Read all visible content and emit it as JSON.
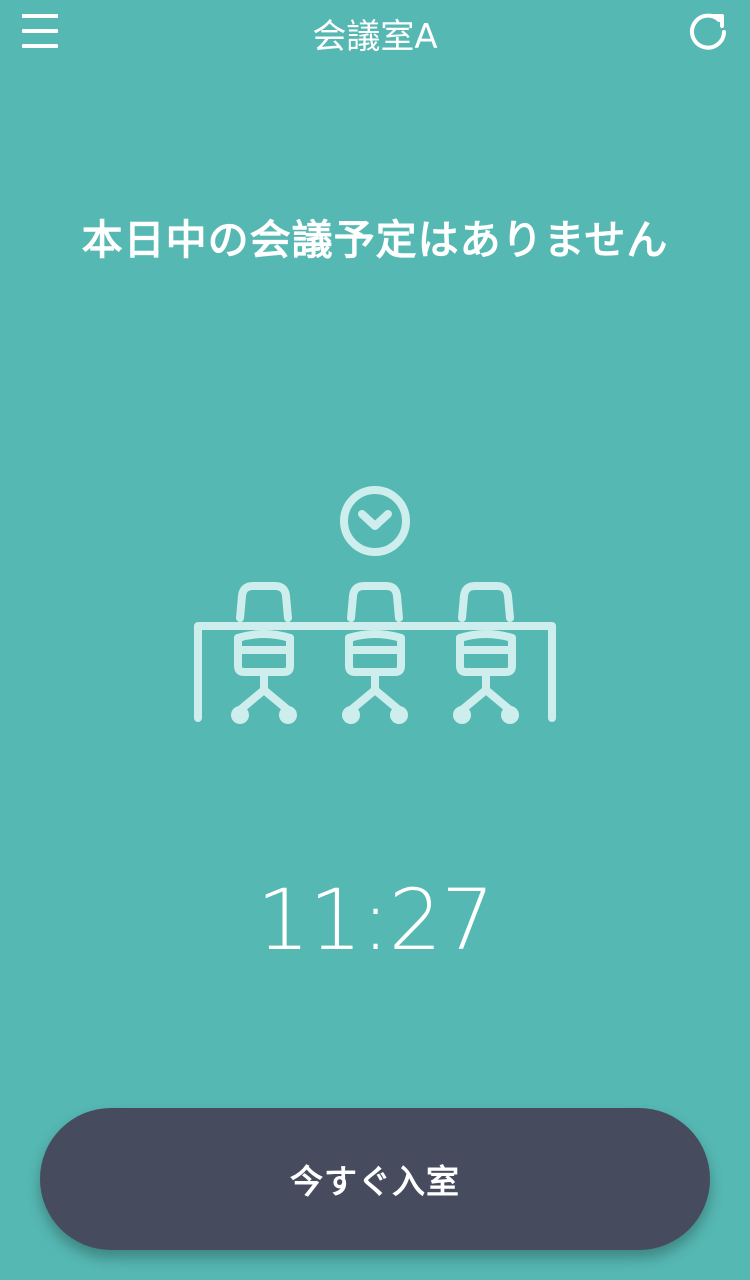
{
  "header": {
    "menu_icon": "hamburger-menu-icon",
    "title": "会議室A",
    "refresh_icon": "refresh-icon"
  },
  "main": {
    "no_meeting_message": "本日中の会議予定はありません",
    "illustration_icon": "meeting-room-illustration",
    "current_time": "11:27"
  },
  "footer": {
    "enter_button_label": "今すぐ入室"
  },
  "colors": {
    "background": "#56b8b3",
    "illustration": "#cdeeed",
    "button": "#464b5e",
    "text": "#ffffff"
  }
}
